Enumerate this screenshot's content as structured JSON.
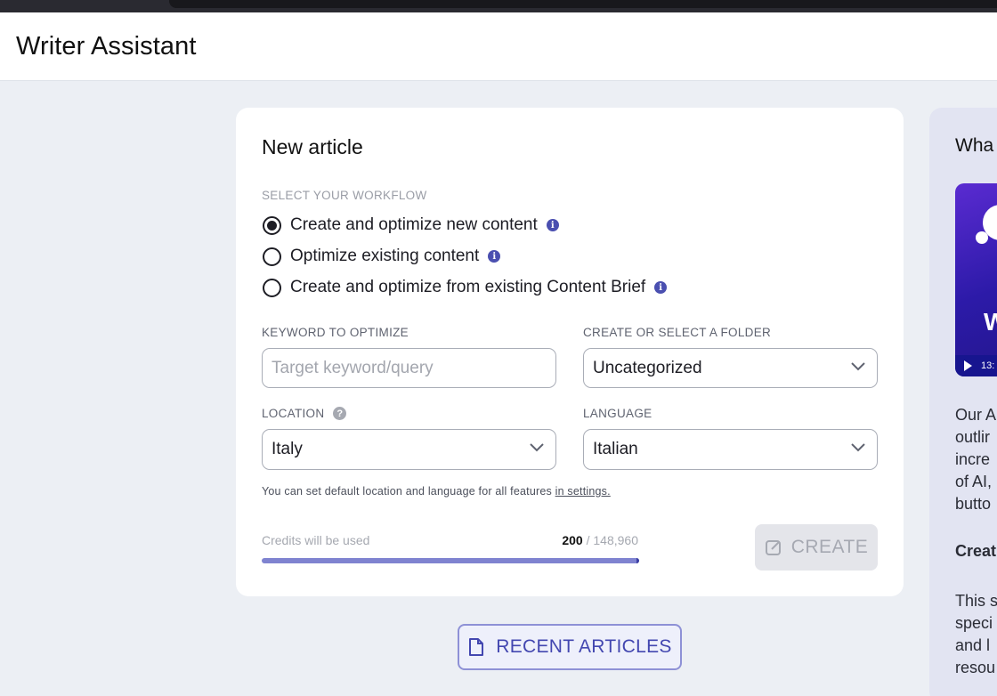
{
  "app": {
    "title": "Writer Assistant"
  },
  "card": {
    "title": "New article",
    "workflow_label": "SELECT YOUR WORKFLOW",
    "workflows": [
      {
        "label": "Create and optimize new content",
        "checked": true
      },
      {
        "label": "Optimize existing content",
        "checked": false
      },
      {
        "label": "Create and optimize from existing Content Brief",
        "checked": false
      }
    ],
    "keyword": {
      "label": "KEYWORD TO OPTIMIZE",
      "placeholder": "Target keyword/query",
      "value": ""
    },
    "folder": {
      "label": "CREATE OR SELECT A FOLDER",
      "value": "Uncategorized"
    },
    "location": {
      "label": "LOCATION",
      "value": "Italy"
    },
    "language": {
      "label": "LANGUAGE",
      "value": "Italian"
    },
    "note": {
      "text": "You can set default location and language for all features ",
      "link": "in settings."
    },
    "credits": {
      "label": "Credits will be used",
      "used": "200",
      "total": "/ 148,960"
    },
    "create_label": "CREATE"
  },
  "recent_label": "RECENT ARTICLES",
  "side": {
    "title": "Wha",
    "video_letter": "W",
    "video_time": "13:",
    "lines": [
      "Our A",
      "outlir",
      "incre",
      "of AI,",
      "butto"
    ],
    "subheading": "Creat",
    "lines2": [
      "This s",
      "speci",
      "and l",
      "resou"
    ]
  },
  "colors": {
    "accent": "#4347b0",
    "progress": "#7f83d0",
    "info": "#4a4fb0"
  }
}
